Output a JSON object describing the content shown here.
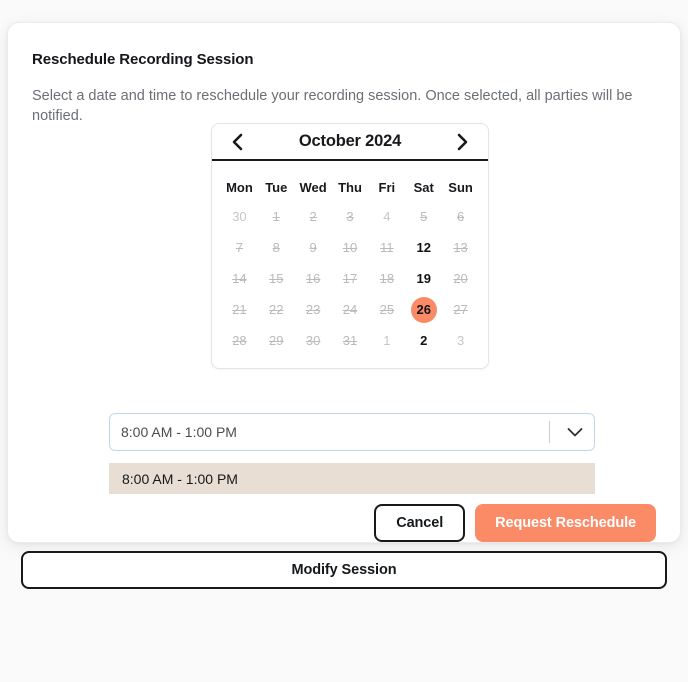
{
  "modal": {
    "title": "Reschedule Recording Session",
    "description": "Select a date and time to reschedule your recording session. Once selected, all parties will be notified."
  },
  "calendar": {
    "month_label": "October 2024",
    "prev_icon": "chevron-left-icon",
    "next_icon": "chevron-right-icon",
    "weekdays": [
      "Mon",
      "Tue",
      "Wed",
      "Thu",
      "Fri",
      "Sat",
      "Sun"
    ],
    "selected_day": "26",
    "weeks": [
      [
        {
          "day": "30",
          "state": "outside"
        },
        {
          "day": "1",
          "state": "disabled"
        },
        {
          "day": "2",
          "state": "disabled"
        },
        {
          "day": "3",
          "state": "disabled"
        },
        {
          "day": "4",
          "state": "outside"
        },
        {
          "day": "5",
          "state": "disabled"
        },
        {
          "day": "6",
          "state": "disabled"
        }
      ],
      [
        {
          "day": "7",
          "state": "disabled"
        },
        {
          "day": "8",
          "state": "disabled"
        },
        {
          "day": "9",
          "state": "disabled"
        },
        {
          "day": "10",
          "state": "disabled"
        },
        {
          "day": "11",
          "state": "disabled"
        },
        {
          "day": "12",
          "state": "available"
        },
        {
          "day": "13",
          "state": "disabled"
        }
      ],
      [
        {
          "day": "14",
          "state": "disabled"
        },
        {
          "day": "15",
          "state": "disabled"
        },
        {
          "day": "16",
          "state": "disabled"
        },
        {
          "day": "17",
          "state": "disabled"
        },
        {
          "day": "18",
          "state": "disabled"
        },
        {
          "day": "19",
          "state": "available"
        },
        {
          "day": "20",
          "state": "disabled"
        }
      ],
      [
        {
          "day": "21",
          "state": "disabled"
        },
        {
          "day": "22",
          "state": "disabled"
        },
        {
          "day": "23",
          "state": "disabled"
        },
        {
          "day": "24",
          "state": "disabled"
        },
        {
          "day": "25",
          "state": "disabled"
        },
        {
          "day": "26",
          "state": "selected"
        },
        {
          "day": "27",
          "state": "disabled"
        }
      ],
      [
        {
          "day": "28",
          "state": "disabled"
        },
        {
          "day": "29",
          "state": "disabled"
        },
        {
          "day": "30",
          "state": "disabled"
        },
        {
          "day": "31",
          "state": "disabled"
        },
        {
          "day": "1",
          "state": "outside"
        },
        {
          "day": "2",
          "state": "available"
        },
        {
          "day": "3",
          "state": "outside"
        }
      ]
    ]
  },
  "time_select": {
    "selected_value": "8:00 AM - 1:00 PM",
    "caret_icon": "chevron-down-icon",
    "options": [
      {
        "label": "8:00 AM - 1:00 PM",
        "highlighted": true
      }
    ]
  },
  "actions": {
    "cancel_label": "Cancel",
    "primary_label": "Request Reschedule"
  },
  "page": {
    "modify_session_label": "Modify Session"
  },
  "colors": {
    "accent": "#fb8a67",
    "option_highlight": "#e8ded4",
    "select_focus_border": "#bcd9f2",
    "text_primary": "#15181b",
    "text_muted": "#6b7076",
    "disabled_day": "#b9bbbe"
  }
}
